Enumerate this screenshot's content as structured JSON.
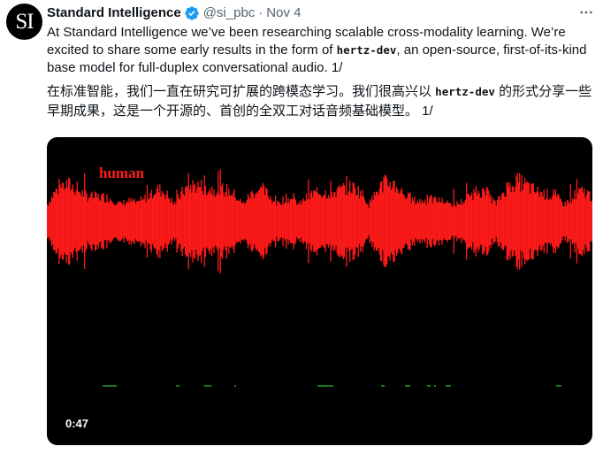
{
  "author": {
    "avatar_text": "SI",
    "display_name": "Standard Intelligence",
    "handle": "@si_pbc",
    "separator": "·",
    "date": "Nov 4"
  },
  "tweet": {
    "p1_before": "At Standard Intelligence we’ve been researching scalable cross-modality learning. We’re excited to share some early results in the form of ",
    "p1_code": "hertz-dev",
    "p1_after": ", an open-source, first-of-its-kind base model for full-duplex conversational audio. 1/",
    "p2_before": "在标准智能，我们一直在研究可扩展的跨模态学习。我们很高兴以 ",
    "p2_code": "hertz-dev",
    "p2_after": " 的形式分享一些早期成果，这是一个开源的、首创的全双工对话音频基础模型。 1/"
  },
  "video": {
    "label": "human",
    "duration": "0:47",
    "wave_color": "#ff1a1a",
    "secondary_color": "#1f7a1f"
  },
  "colors": {
    "verified": "#1d9bf0",
    "secondary_text": "#536471"
  }
}
